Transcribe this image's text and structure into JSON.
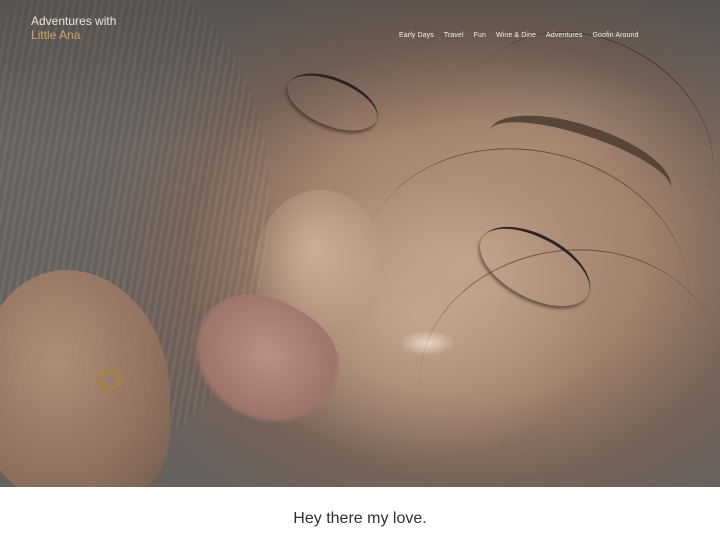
{
  "site": {
    "title_line1": "Adventures with",
    "title_line2": "Little Ana"
  },
  "nav": {
    "items": [
      "Early Days",
      "Travel",
      "Fun",
      "Wine & Dine",
      "Adventures",
      "Goofin Around"
    ]
  },
  "hero": {
    "image": "close-up photo of a sleeping child's face"
  },
  "main": {
    "greeting": "Hey there my love."
  },
  "colors": {
    "brand_accent": "#c9a66b",
    "text_dark": "#2f2f35",
    "page_background": "#ffffff"
  }
}
